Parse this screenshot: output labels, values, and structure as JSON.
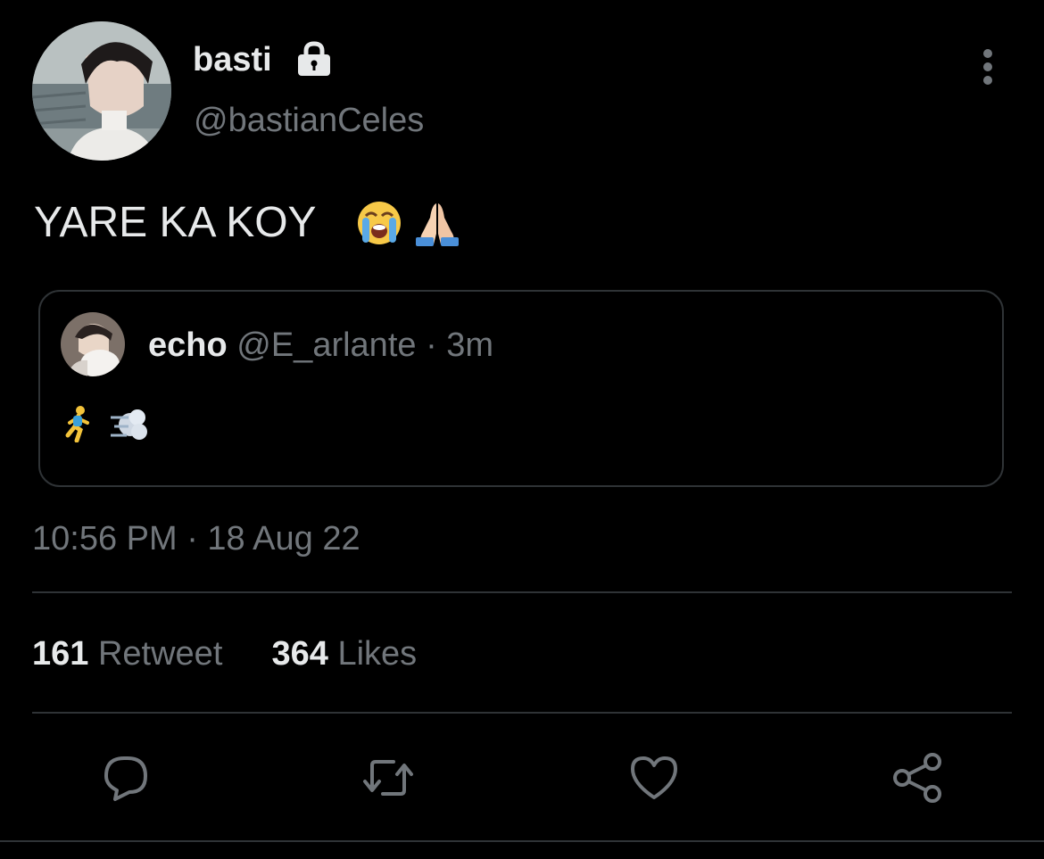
{
  "author": {
    "display_name": "basti",
    "handle": "@bastianCeles",
    "protected": true
  },
  "tweet": {
    "text": "YARE KA KOY",
    "emojis": [
      "loudly-crying-face",
      "folded-hands"
    ],
    "timestamp": "10:56 PM · 18 Aug 22"
  },
  "quoted_tweet": {
    "display_name": "echo",
    "meta": "@E_arlante · 3m",
    "emojis": [
      "person-running",
      "dashing-away"
    ]
  },
  "stats": {
    "retweets": "161",
    "retweets_label": "Retweet",
    "likes": "364",
    "likes_label": "Likes"
  },
  "actions": [
    "reply-icon",
    "retweet-icon",
    "like-icon",
    "share-icon"
  ],
  "colors": {
    "background": "#000000",
    "primary_text": "#e7e9ea",
    "secondary_text": "#71767b",
    "border": "#2f3336"
  }
}
